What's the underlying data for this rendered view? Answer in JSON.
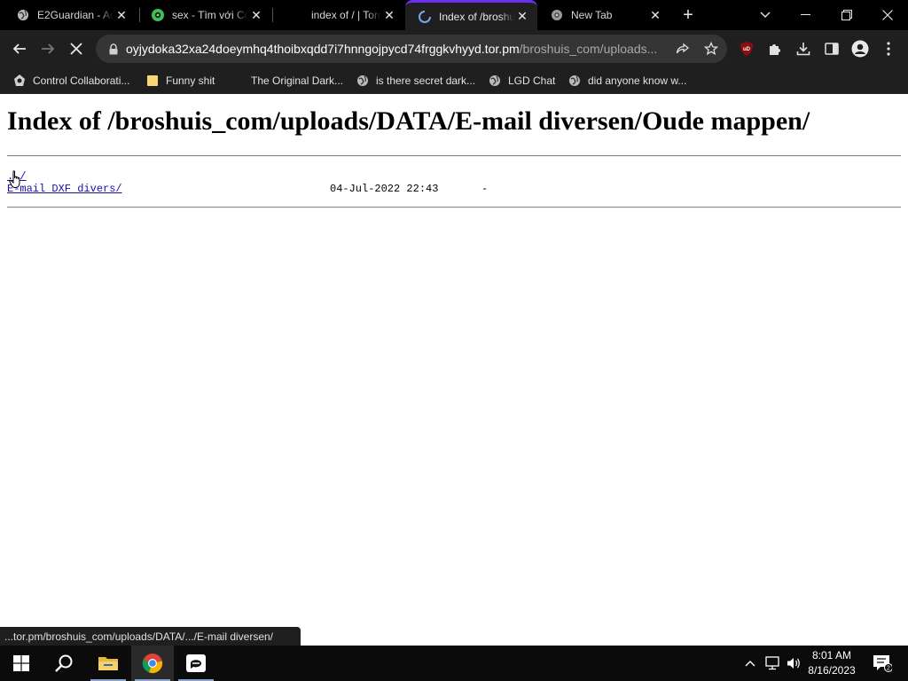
{
  "browser": {
    "tabs": [
      {
        "title": "E2Guardian - Ac",
        "icon": "globe-icon",
        "active": false
      },
      {
        "title": "sex - Tìm với Cô",
        "icon": "coccoc-icon",
        "active": false
      },
      {
        "title": "index of / | Torch",
        "icon": "none",
        "active": false
      },
      {
        "title": "Index of /broshuis",
        "icon": "loading-spinner-icon",
        "active": true
      },
      {
        "title": "New Tab",
        "icon": "chrome-icon",
        "active": false
      }
    ],
    "new_tab_symbol": "+",
    "address": {
      "host": "oyjydoka32xa24doeymhq4thoibxqdd7i7hnngojpycd74frggkvhyyd.tor.pm",
      "path": "/broshuis_com/uploads..."
    },
    "extension_badge": "uD",
    "bookmarks": [
      {
        "label": "Control Collaborati...",
        "icon": "cc-icon"
      },
      {
        "label": "Funny shit",
        "icon": "folder-icon"
      },
      {
        "label": "The Original Dark...",
        "icon": "none"
      },
      {
        "label": "is there secret dark...",
        "icon": "globe-icon"
      },
      {
        "label": "LGD Chat",
        "icon": "globe-icon"
      },
      {
        "label": "did anyone know w...",
        "icon": "globe-icon"
      }
    ],
    "status_text": "...tor.pm/broshuis_com/uploads/DATA/.../E-mail diversen/"
  },
  "page": {
    "heading": "Index of /broshuis_com/uploads/DATA/E-mail diversen/Oude mappen/",
    "parent_link": "../",
    "entries": [
      {
        "name": "E-mail DXF divers/",
        "date": "04-Jul-2022 22:43",
        "size": "-"
      }
    ]
  },
  "taskbar": {
    "time": "8:01 AM",
    "date": "8/16/2023",
    "notification_count": "2"
  },
  "colors": {
    "active_tab_accent": "#6a2ff2",
    "chrome_bg": "#1f1f1f",
    "link": "#1a0dab"
  }
}
